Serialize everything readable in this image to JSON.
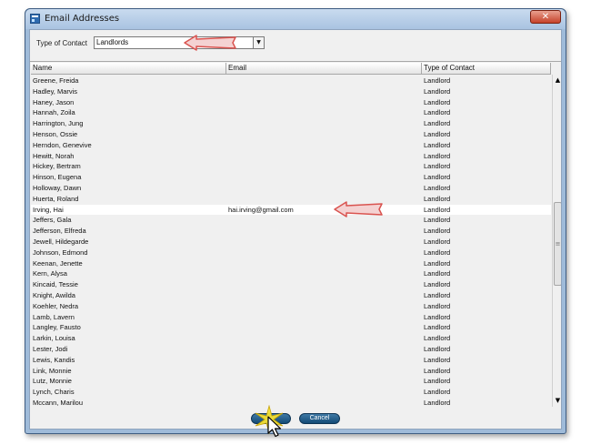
{
  "window": {
    "title": "Email Addresses",
    "close_glyph": "✕"
  },
  "filter": {
    "label": "Type of Contact",
    "value": "Landlords",
    "dropdown_glyph": "▼"
  },
  "table": {
    "columns": [
      "Name",
      "Email",
      "Type of Contact"
    ],
    "rows": [
      {
        "name": "Greene, Freida",
        "email": "",
        "type": "Landlord"
      },
      {
        "name": "Hadley, Marvis",
        "email": "",
        "type": "Landlord"
      },
      {
        "name": "Haney, Jason",
        "email": "",
        "type": "Landlord"
      },
      {
        "name": "Hannah, Zoila",
        "email": "",
        "type": "Landlord"
      },
      {
        "name": "Harrington, Jung",
        "email": "",
        "type": "Landlord"
      },
      {
        "name": "Henson, Ossie",
        "email": "",
        "type": "Landlord"
      },
      {
        "name": "Herndon, Genevive",
        "email": "",
        "type": "Landlord"
      },
      {
        "name": "Hewitt, Norah",
        "email": "",
        "type": "Landlord"
      },
      {
        "name": "Hickey, Bertram",
        "email": "",
        "type": "Landlord"
      },
      {
        "name": "Hinson, Eugena",
        "email": "",
        "type": "Landlord"
      },
      {
        "name": "Holloway, Dawn",
        "email": "",
        "type": "Landlord"
      },
      {
        "name": "Huerta, Roland",
        "email": "",
        "type": "Landlord"
      },
      {
        "name": "Irving, Hai",
        "email": "hai.irving@gmail.com",
        "type": "Landlord",
        "selected": true
      },
      {
        "name": "Jeffers, Gala",
        "email": "",
        "type": "Landlord"
      },
      {
        "name": "Jefferson, Elfreda",
        "email": "",
        "type": "Landlord"
      },
      {
        "name": "Jewell, Hildegarde",
        "email": "",
        "type": "Landlord"
      },
      {
        "name": "Johnson, Edmond",
        "email": "",
        "type": "Landlord"
      },
      {
        "name": "Keenan, Jenette",
        "email": "",
        "type": "Landlord"
      },
      {
        "name": "Kern, Alysa",
        "email": "",
        "type": "Landlord"
      },
      {
        "name": "Kincaid, Tessie",
        "email": "",
        "type": "Landlord"
      },
      {
        "name": "Knight, Awilda",
        "email": "",
        "type": "Landlord"
      },
      {
        "name": "Koehler, Nedra",
        "email": "",
        "type": "Landlord"
      },
      {
        "name": "Lamb, Lavern",
        "email": "",
        "type": "Landlord"
      },
      {
        "name": "Langley, Fausto",
        "email": "",
        "type": "Landlord"
      },
      {
        "name": "Larkin, Louisa",
        "email": "",
        "type": "Landlord"
      },
      {
        "name": "Lester, Jodi",
        "email": "",
        "type": "Landlord"
      },
      {
        "name": "Lewis, Kandis",
        "email": "",
        "type": "Landlord"
      },
      {
        "name": "Link, Monnie",
        "email": "",
        "type": "Landlord"
      },
      {
        "name": "Lutz, Monnie",
        "email": "",
        "type": "Landlord"
      },
      {
        "name": "Lynch, Charis",
        "email": "",
        "type": "Landlord"
      },
      {
        "name": "Mccann, Marilou",
        "email": "",
        "type": "Landlord"
      }
    ]
  },
  "scrollbar": {
    "up_glyph": "▲",
    "down_glyph": "▼",
    "thumb_grip": "≡"
  },
  "buttons": {
    "ok_label": "",
    "cancel_label": "Cancel"
  },
  "colors": {
    "button_blue": "#1f5a88",
    "arrow_red": "#d9534f",
    "highlight_yellow": "#f5e233",
    "window_frame": "#9fbbd9"
  }
}
